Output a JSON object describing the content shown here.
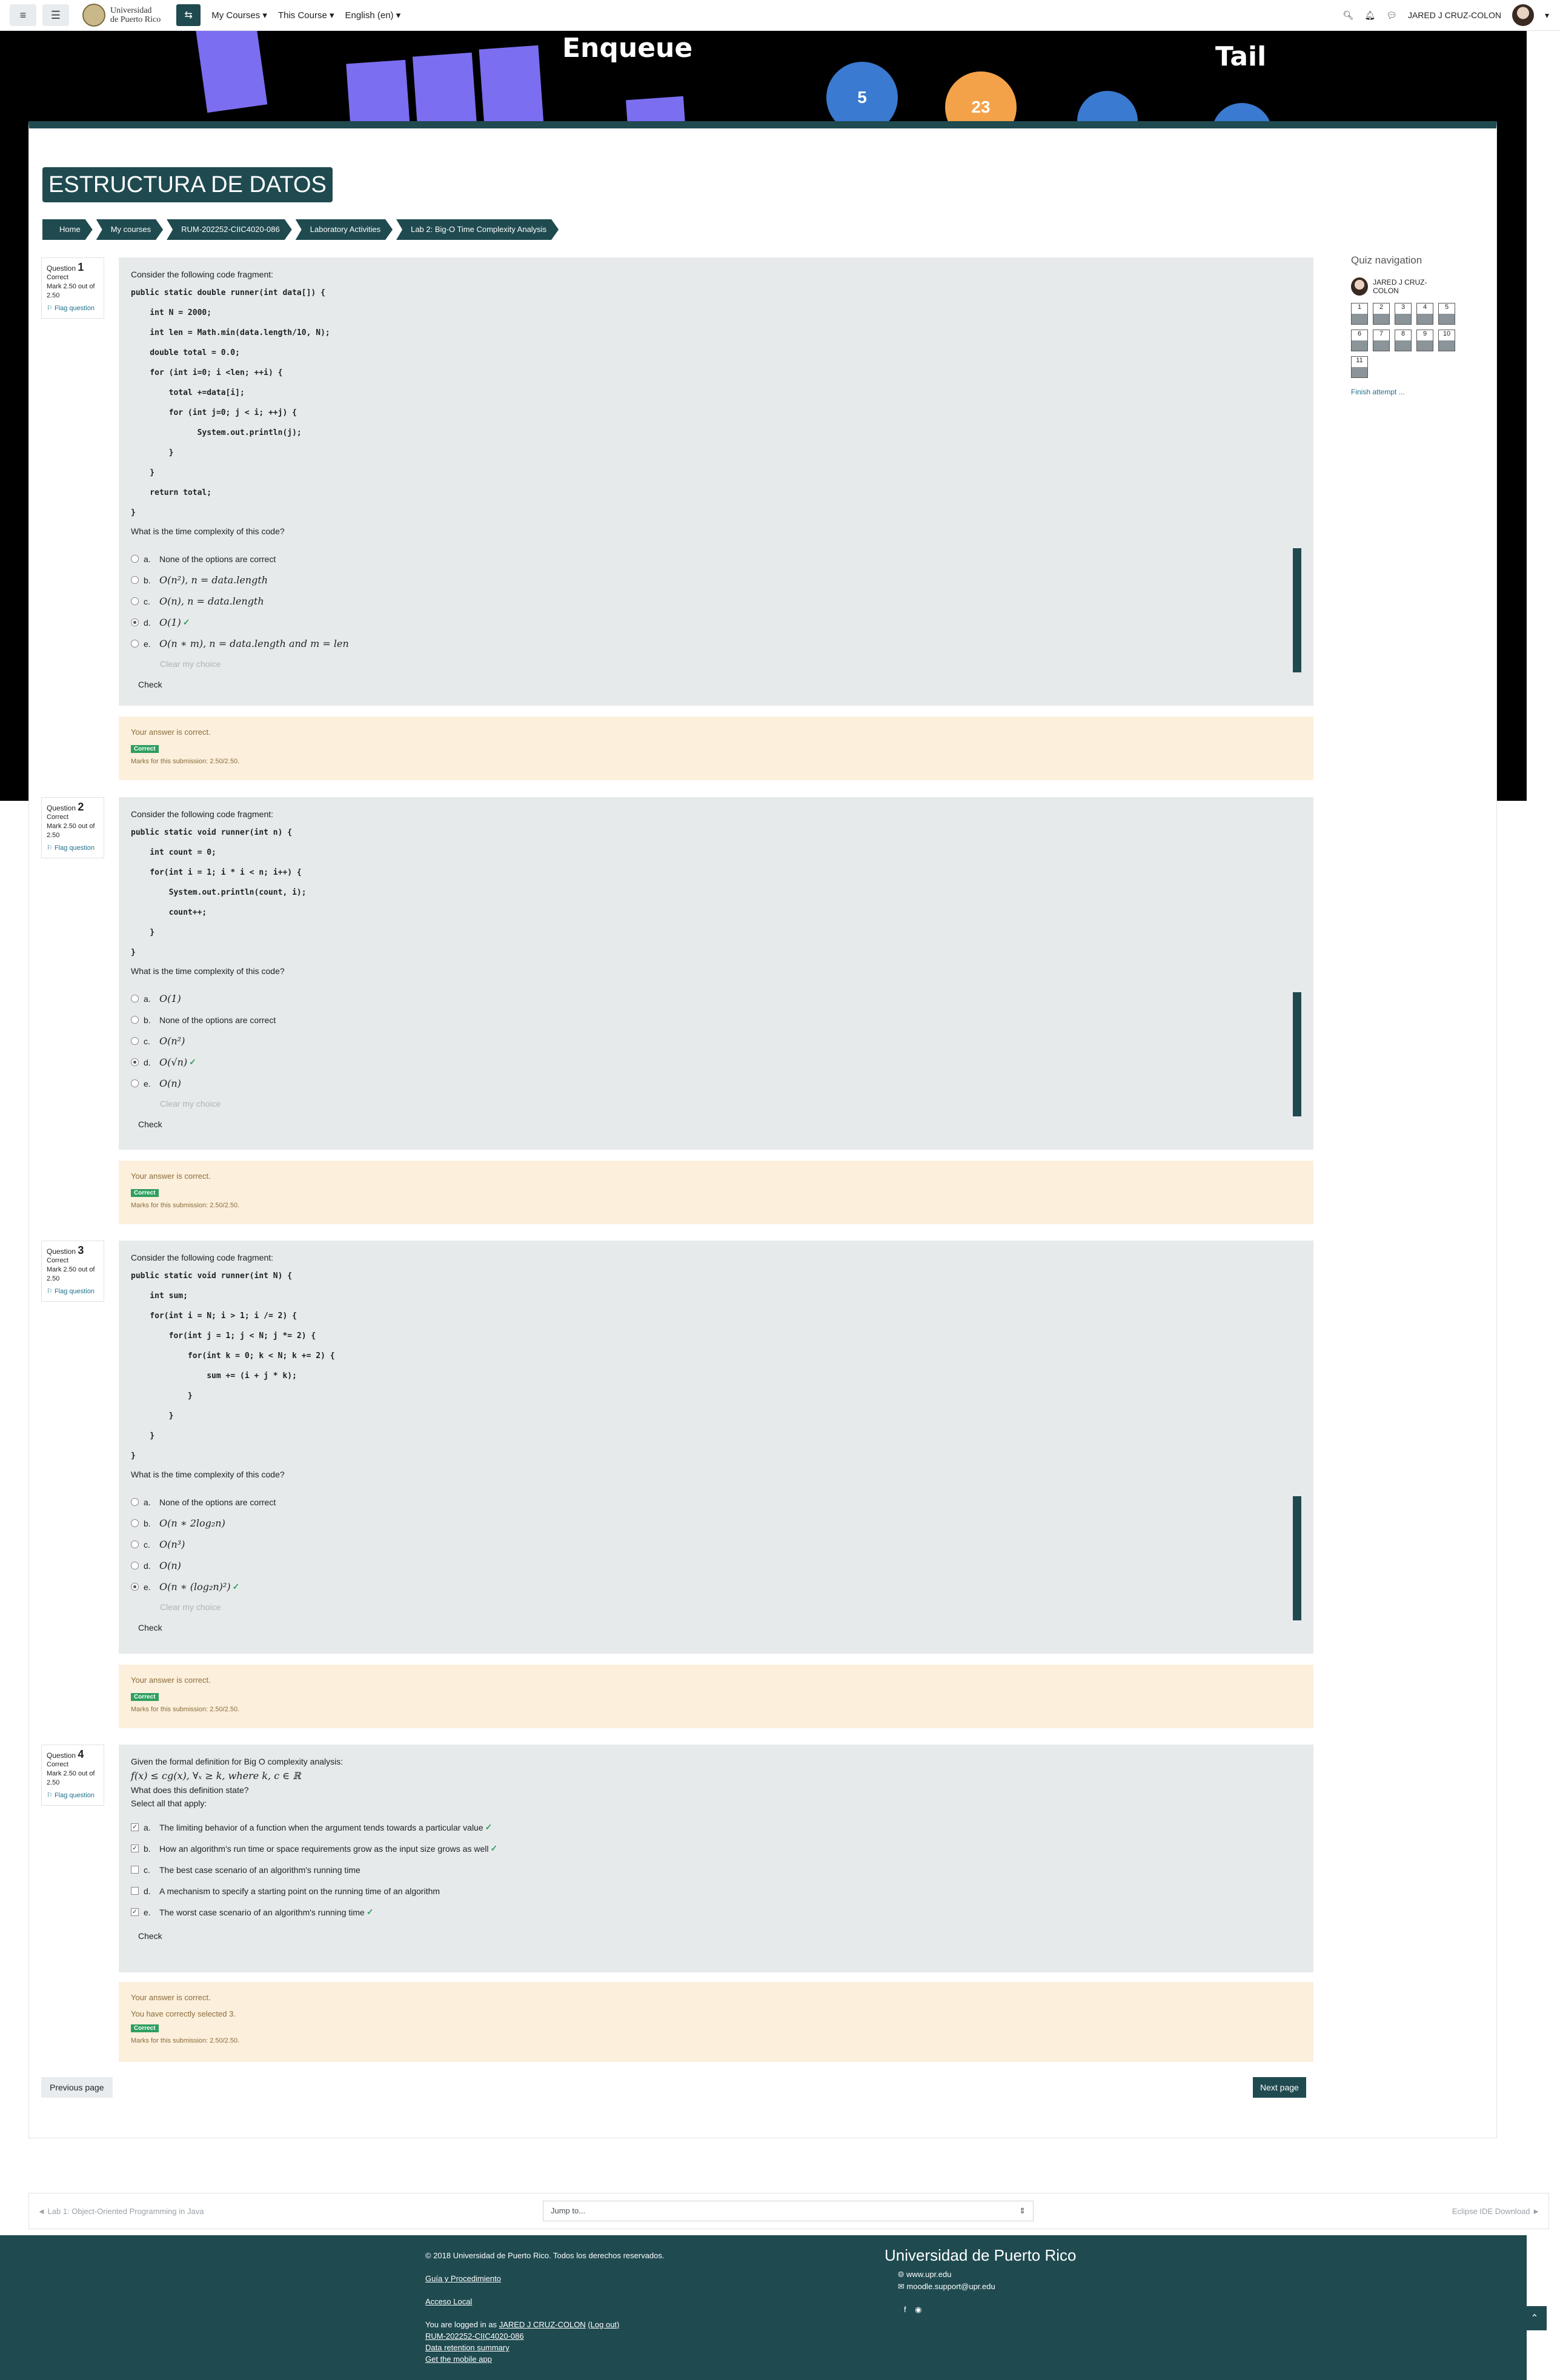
{
  "navbar": {
    "logo_line1": "Universidad",
    "logo_line2": "de Puerto Rico",
    "my_courses": "My Courses ▾",
    "this_course": "This Course ▾",
    "language": "English (en) ▾",
    "user": "JARED J CRUZ-COLON"
  },
  "hero": {
    "word1": "Enqueue",
    "word2": "Tail",
    "n1": "5",
    "n2": "23"
  },
  "course_title": "ESTRUCTURA DE DATOS",
  "breadcrumb": [
    "Home",
    "My courses",
    "RUM-202252-CIIC4020-086",
    "Laboratory Activities",
    "Lab 2: Big-O Time Complexity Analysis"
  ],
  "common": {
    "question_word": "Question",
    "state": "Correct",
    "mark": "Mark 2.50 out of 2.50",
    "flag": "Flag question",
    "clear": "Clear my choice",
    "check": "Check",
    "fb_correct": "Your answer is correct.",
    "badge": "Correct",
    "marks_sub": "Marks for this submission: 2.50/2.50.",
    "intro": "Consider the following code fragment:",
    "prompt": "What is the time complexity of this code?"
  },
  "q1": {
    "num": "1",
    "code": "public static double runner(int data[]) {\n    int N = 2000;\n    int len = Math.min(data.length/10, N);\n    double total = 0.0;\n    for (int i=0; i <len; ++i) {\n        total +=data[i];\n        for (int j=0; j < i; ++j) {\n              System.out.println(j);\n        }\n    }\n    return total;\n}",
    "options": [
      {
        "l": "a.",
        "t": "None of the options are correct",
        "m": false
      },
      {
        "l": "b.",
        "t": "O(n²), n = data.length",
        "m": true
      },
      {
        "l": "c.",
        "t": "O(n), n = data.length",
        "m": true
      },
      {
        "l": "d.",
        "t": "O(1)",
        "m": true
      },
      {
        "l": "e.",
        "t": "O(n ∗ m), n = data.length and m = len",
        "m": true
      }
    ]
  },
  "q2": {
    "num": "2",
    "code": "public static void runner(int n) {\n    int count = 0;\n    for(int i = 1; i * i < n; i++) {\n        System.out.println(count, i);\n        count++;\n    }\n}",
    "options": [
      {
        "l": "a.",
        "t": "O(1)"
      },
      {
        "l": "b.",
        "t": "None of the options are correct"
      },
      {
        "l": "c.",
        "t": "O(n²)"
      },
      {
        "l": "d.",
        "t": "O(√n)"
      },
      {
        "l": "e.",
        "t": "O(n)"
      }
    ]
  },
  "q3": {
    "num": "3",
    "code": "public static void runner(int N) {\n    int sum;\n    for(int i = N; i > 1; i /= 2) {\n        for(int j = 1; j < N; j *= 2) {\n            for(int k = 0; k < N; k += 2) {\n                sum += (i + j * k);\n            }\n        }\n    }\n}",
    "options": [
      {
        "l": "a.",
        "t": "None of the options are correct"
      },
      {
        "l": "b.",
        "t": "O(n ∗ 2log₂n)"
      },
      {
        "l": "c.",
        "t": "O(n³)"
      },
      {
        "l": "d.",
        "t": "O(n)"
      },
      {
        "l": "e.",
        "t": "O(n ∗ (log₂n)²)"
      }
    ]
  },
  "q4": {
    "num": "4",
    "intro": "Given the formal definition for Big O complexity analysis:",
    "formula": "f(x) ≤ cg(x), ∀ₓ ≥ k, where k, c ∈ ℝ",
    "q": "What does this definition state?",
    "select": "Select all that apply:",
    "options": [
      {
        "l": "a.",
        "t": "The limiting behavior of a function when the argument tends towards a particular value"
      },
      {
        "l": "b.",
        "t": "How an algorithm's run time or space requirements grow as the input size grows as well"
      },
      {
        "l": "c.",
        "t": "The best case scenario of an algorithm's running time"
      },
      {
        "l": "d.",
        "t": "A mechanism to specify a starting point on the running time of an algorithm"
      },
      {
        "l": "e.",
        "t": "The worst case scenario of an algorithm's running time"
      }
    ],
    "selected_count": "You have correctly selected 3."
  },
  "quiz_nav": {
    "title": "Quiz navigation",
    "user": "JARED J CRUZ-COLON",
    "cells": [
      "1",
      "2",
      "3",
      "4",
      "5",
      "6",
      "7",
      "8",
      "9",
      "10",
      "11"
    ],
    "finish": "Finish attempt ..."
  },
  "buttons": {
    "prev": "Previous page",
    "next": "Next page"
  },
  "activity_nav": {
    "prev": "◄ Lab 1: Object-Oriented Programming in Java",
    "jump": "Jump to...",
    "next": "Eclipse IDE Download ►"
  },
  "footer": {
    "copyright": "© 2018 Universidad de Puerto Rico. Todos los derechos reservados.",
    "guia": "Guía y Procedimiento",
    "acceso": "Acceso Local",
    "logged": "You are logged in as",
    "user": "JARED J CRUZ-COLON",
    "logout": "(Log out)",
    "course": "RUM-202252-CIIC4020-086",
    "retention": "Data retention summary",
    "app": "Get the mobile app",
    "uni": "Universidad de Puerto Rico",
    "web": "www.upr.edu",
    "mail": "moodle.support@upr.edu"
  }
}
